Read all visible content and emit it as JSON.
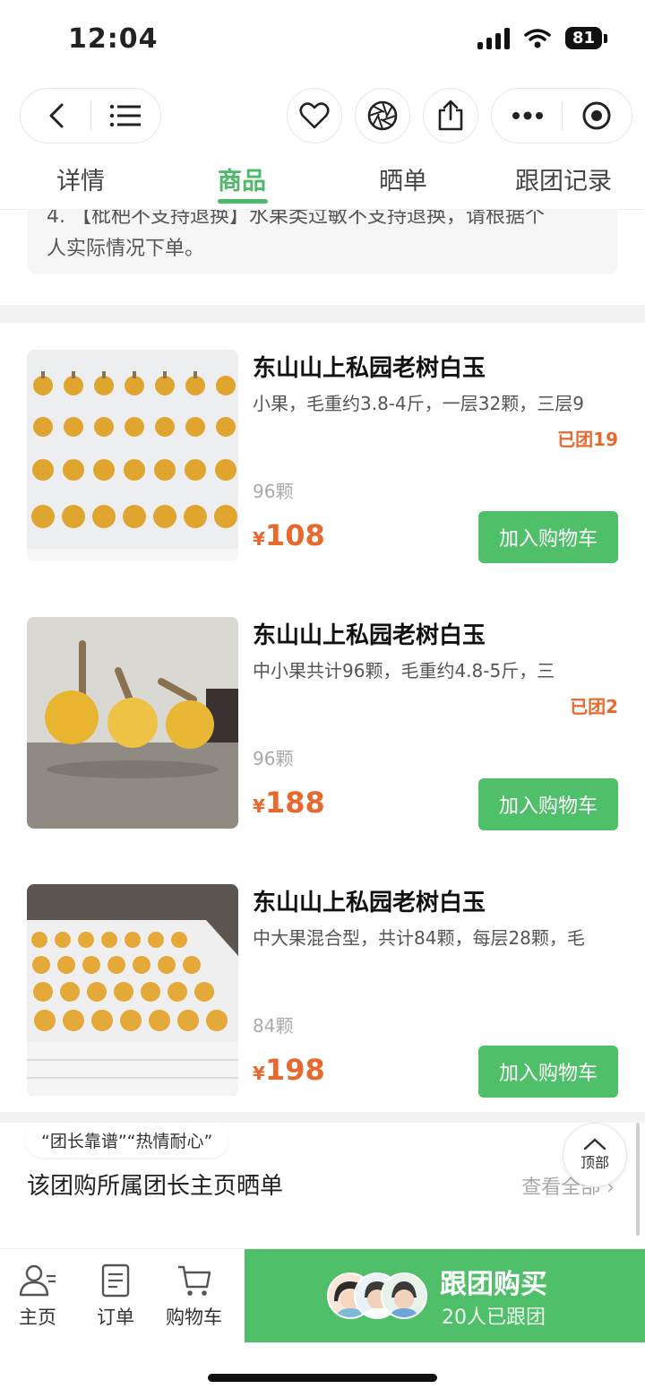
{
  "status_bar": {
    "time": "12:04",
    "battery": "81"
  },
  "header": {
    "back_icon": "chevron-left-icon",
    "menu_icon": "list-icon",
    "favorite_icon": "heart-icon",
    "camera_icon": "aperture-icon",
    "share_icon": "share-icon",
    "more_icon": "more-dots-icon",
    "close_icon": "target-circle-icon"
  },
  "tabs": [
    "详情",
    "商品",
    "晒单",
    "跟团记录"
  ],
  "active_tab": "商品",
  "notice": {
    "line1": "4. 【枇杷不支持退换】水果类过敏不支持退换，请根据个",
    "line2": "人实际情况下单。"
  },
  "products": [
    {
      "title": "东山山上私园老树白玉",
      "desc": "小果，毛重约3.8-4斤，一层32颗，三层9",
      "joined": "已团19",
      "count": "96颗",
      "currency": "¥",
      "price": "108",
      "button": "加入购物车"
    },
    {
      "title": "东山山上私园老树白玉",
      "desc": "中小果共计96颗，毛重约4.8-5斤，三",
      "joined": "已团2",
      "count": "96颗",
      "currency": "¥",
      "price": "188",
      "button": "加入购物车"
    },
    {
      "title": "东山山上私园老树白玉",
      "desc": "中大果混合型，共计84颗，每层28颗，毛",
      "joined": "",
      "count": "84颗",
      "currency": "¥",
      "price": "198",
      "button": "加入购物车"
    }
  ],
  "reviews": {
    "tags": "“团长靠谱”“热情耐心”",
    "title": "该团购所属团长主页晒单",
    "more": "查看全部 ›"
  },
  "back_to_top": "顶部",
  "bottom_nav": {
    "home": "主页",
    "orders": "订单",
    "cart": "购物车"
  },
  "buy_button": {
    "title": "跟团购买",
    "subtitle": "20人已跟团"
  },
  "colors": {
    "accent_green": "#4fbf69",
    "price_orange": "#e8692d"
  }
}
